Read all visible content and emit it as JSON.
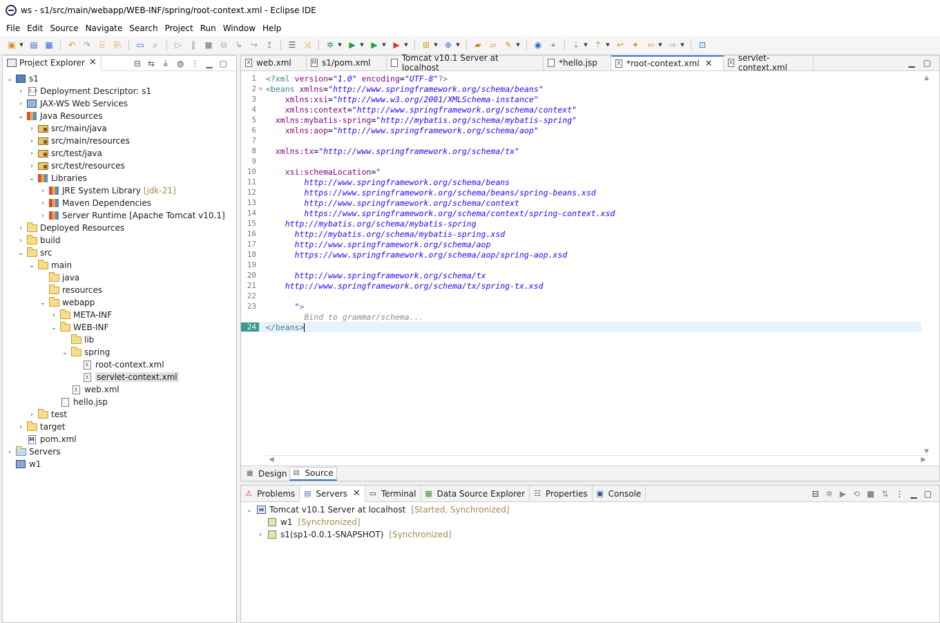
{
  "window": {
    "title": "ws - s1/src/main/webapp/WEB-INF/spring/root-context.xml - Eclipse IDE"
  },
  "menu": [
    "File",
    "Edit",
    "Source",
    "Navigate",
    "Search",
    "Project",
    "Run",
    "Window",
    "Help"
  ],
  "explorer": {
    "tab_label": "Project Explorer",
    "tree": [
      {
        "level": 0,
        "twisty": "open",
        "icon": "project",
        "label": "s1",
        "decoration": ""
      },
      {
        "level": 1,
        "twisty": "closed",
        "icon": "descriptor",
        "label": "Deployment Descriptor: s1",
        "decoration": ""
      },
      {
        "level": 1,
        "twisty": "closed",
        "icon": "webservices",
        "label": "JAX-WS Web Services",
        "decoration": ""
      },
      {
        "level": 1,
        "twisty": "open",
        "icon": "java-resources",
        "label": "Java Resources",
        "decoration": ""
      },
      {
        "level": 2,
        "twisty": "closed",
        "icon": "source-folder",
        "label": "src/main/java",
        "decoration": ""
      },
      {
        "level": 2,
        "twisty": "closed",
        "icon": "source-folder",
        "label": "src/main/resources",
        "decoration": ""
      },
      {
        "level": 2,
        "twisty": "closed",
        "icon": "source-folder",
        "label": "src/test/java",
        "decoration": ""
      },
      {
        "level": 2,
        "twisty": "closed",
        "icon": "source-folder",
        "label": "src/test/resources",
        "decoration": ""
      },
      {
        "level": 2,
        "twisty": "open",
        "icon": "library",
        "label": "Libraries",
        "decoration": ""
      },
      {
        "level": 3,
        "twisty": "closed",
        "icon": "library",
        "label": "JRE System Library",
        "decoration": "[jdk-21]"
      },
      {
        "level": 3,
        "twisty": "closed",
        "icon": "library",
        "label": "Maven Dependencies",
        "decoration": ""
      },
      {
        "level": 3,
        "twisty": "closed",
        "icon": "library",
        "label": "Server Runtime [Apache Tomcat v10.1]",
        "decoration": ""
      },
      {
        "level": 1,
        "twisty": "closed",
        "icon": "folder",
        "label": "Deployed Resources",
        "decoration": ""
      },
      {
        "level": 1,
        "twisty": "closed",
        "icon": "folder",
        "label": "build",
        "decoration": ""
      },
      {
        "level": 1,
        "twisty": "open",
        "icon": "folder",
        "label": "src",
        "decoration": ""
      },
      {
        "level": 2,
        "twisty": "open",
        "icon": "folder",
        "label": "main",
        "decoration": ""
      },
      {
        "level": 3,
        "twisty": "none",
        "icon": "folder",
        "label": "java",
        "decoration": ""
      },
      {
        "level": 3,
        "twisty": "none",
        "icon": "folder",
        "label": "resources",
        "decoration": ""
      },
      {
        "level": 3,
        "twisty": "open",
        "icon": "folder",
        "label": "webapp",
        "decoration": ""
      },
      {
        "level": 4,
        "twisty": "closed",
        "icon": "folder",
        "label": "META-INF",
        "decoration": ""
      },
      {
        "level": 4,
        "twisty": "open",
        "icon": "folder",
        "label": "WEB-INF",
        "decoration": ""
      },
      {
        "level": 5,
        "twisty": "none",
        "icon": "folder",
        "label": "lib",
        "decoration": ""
      },
      {
        "level": 5,
        "twisty": "open",
        "icon": "folder",
        "label": "spring",
        "decoration": ""
      },
      {
        "level": 6,
        "twisty": "none",
        "icon": "xml",
        "label": "root-context.xml",
        "decoration": ""
      },
      {
        "level": 6,
        "twisty": "none",
        "icon": "xml",
        "label": "servlet-context.xml",
        "decoration": "",
        "selected": true
      },
      {
        "level": 5,
        "twisty": "none",
        "icon": "xml",
        "label": "web.xml",
        "decoration": ""
      },
      {
        "level": 4,
        "twisty": "none",
        "icon": "jsp",
        "label": "hello.jsp",
        "decoration": ""
      },
      {
        "level": 2,
        "twisty": "closed",
        "icon": "folder",
        "label": "test",
        "decoration": ""
      },
      {
        "level": 1,
        "twisty": "closed",
        "icon": "folder",
        "label": "target",
        "decoration": ""
      },
      {
        "level": 1,
        "twisty": "none",
        "icon": "maven",
        "label": "pom.xml",
        "decoration": ""
      },
      {
        "level": 0,
        "twisty": "closed",
        "icon": "server-folder",
        "label": "Servers",
        "decoration": ""
      },
      {
        "level": 0,
        "twisty": "none",
        "icon": "project-closed",
        "label": "w1",
        "decoration": ""
      }
    ]
  },
  "editor": {
    "tabs": [
      {
        "label": "web.xml",
        "icon": "x",
        "active": false,
        "closable": false
      },
      {
        "label": "s1/pom.xml",
        "icon": "m",
        "active": false,
        "closable": false
      },
      {
        "label": "Tomcat v10.1 Server at localhost",
        "icon": "server",
        "active": false,
        "closable": false
      },
      {
        "label": "*hello.jsp",
        "icon": "jsp",
        "active": false,
        "closable": false
      },
      {
        "label": "*root-context.xml",
        "icon": "x",
        "active": true,
        "closable": true
      },
      {
        "label": "servlet-context.xml",
        "icon": "x",
        "active": false,
        "closable": false
      }
    ],
    "lines": [
      {
        "n": "1",
        "fold": "",
        "tokens": [
          [
            "tag",
            "<?xml "
          ],
          [
            "attr",
            "version"
          ],
          [
            "plain",
            "="
          ],
          [
            "val",
            "\"1.0\""
          ],
          [
            "plain",
            " "
          ],
          [
            "attr",
            "encoding"
          ],
          [
            "plain",
            "="
          ],
          [
            "val",
            "\"UTF-8\""
          ],
          [
            "tag",
            "?>"
          ]
        ]
      },
      {
        "n": "2",
        "fold": "⊖",
        "tokens": [
          [
            "tag",
            "<beans "
          ],
          [
            "attr",
            "xmlns"
          ],
          [
            "plain",
            "="
          ],
          [
            "val",
            "\"http://www.springframework.org/schema/beans\""
          ]
        ]
      },
      {
        "n": "3",
        "fold": "",
        "tokens": [
          [
            "plain",
            "    "
          ],
          [
            "attr",
            "xmlns:xsi"
          ],
          [
            "plain",
            "="
          ],
          [
            "val",
            "\"http://www.w3.org/2001/XMLSchema-instance\""
          ]
        ]
      },
      {
        "n": "4",
        "fold": "",
        "tokens": [
          [
            "plain",
            "    "
          ],
          [
            "attr",
            "xmlns:context"
          ],
          [
            "plain",
            "="
          ],
          [
            "val",
            "\"http://www.springframework.org/schema/context\""
          ]
        ]
      },
      {
        "n": "5",
        "fold": "",
        "tokens": [
          [
            "plain",
            "  "
          ],
          [
            "attr",
            "xmlns:mybatis-spring"
          ],
          [
            "plain",
            "="
          ],
          [
            "val",
            "\"http://mybatis.org/schema/mybatis-spring\""
          ]
        ]
      },
      {
        "n": "6",
        "fold": "",
        "tokens": [
          [
            "plain",
            "    "
          ],
          [
            "attr",
            "xmlns:aop"
          ],
          [
            "plain",
            "="
          ],
          [
            "val",
            "\"http://www.springframework.org/schema/aop\""
          ]
        ]
      },
      {
        "n": "7",
        "fold": "",
        "tokens": []
      },
      {
        "n": "8",
        "fold": "",
        "tokens": [
          [
            "plain",
            "  "
          ],
          [
            "attr",
            "xmlns:tx"
          ],
          [
            "plain",
            "="
          ],
          [
            "val",
            "\"http://www.springframework.org/schema/tx\""
          ]
        ]
      },
      {
        "n": "9",
        "fold": "",
        "tokens": []
      },
      {
        "n": "10",
        "fold": "",
        "tokens": [
          [
            "plain",
            "    "
          ],
          [
            "attr",
            "xsi:schemaLocation"
          ],
          [
            "plain",
            "="
          ],
          [
            "val",
            "\""
          ]
        ]
      },
      {
        "n": "11",
        "fold": "",
        "tokens": [
          [
            "val",
            "        http://www.springframework.org/schema/beans"
          ]
        ]
      },
      {
        "n": "12",
        "fold": "",
        "tokens": [
          [
            "val",
            "        https://www.springframework.org/schema/beans/spring-beans.xsd"
          ]
        ]
      },
      {
        "n": "13",
        "fold": "",
        "tokens": [
          [
            "val",
            "        http://www.springframework.org/schema/context"
          ]
        ]
      },
      {
        "n": "14",
        "fold": "",
        "tokens": [
          [
            "val",
            "        https://www.springframework.org/schema/context/spring-context.xsd"
          ]
        ]
      },
      {
        "n": "15",
        "fold": "",
        "tokens": [
          [
            "val",
            "    http://mybatis.org/schema/mybatis-spring"
          ]
        ]
      },
      {
        "n": "16",
        "fold": "",
        "tokens": [
          [
            "val",
            "      http://mybatis.org/schema/mybatis-spring.xsd"
          ]
        ]
      },
      {
        "n": "17",
        "fold": "",
        "tokens": [
          [
            "val",
            "      http://www.springframework.org/schema/aop"
          ]
        ]
      },
      {
        "n": "18",
        "fold": "",
        "tokens": [
          [
            "val",
            "      https://www.springframework.org/schema/aop/spring-aop.xsd"
          ]
        ]
      },
      {
        "n": "19",
        "fold": "",
        "tokens": []
      },
      {
        "n": "20",
        "fold": "",
        "tokens": [
          [
            "val",
            "      http://www.springframework.org/schema/tx"
          ]
        ]
      },
      {
        "n": "21",
        "fold": "",
        "tokens": [
          [
            "val",
            "    http://www.springframework.org/schema/tx/spring-tx.xsd"
          ]
        ]
      },
      {
        "n": "22",
        "fold": "",
        "tokens": []
      },
      {
        "n": "23",
        "fold": "",
        "tokens": [
          [
            "val",
            "      \""
          ],
          [
            "tag",
            ">"
          ]
        ]
      },
      {
        "n": "",
        "fold": "",
        "tokens": [
          [
            "hint",
            "        Bind to grammar/schema..."
          ]
        ]
      },
      {
        "n": "24",
        "fold": "",
        "tokens": [
          [
            "tag",
            "</beans>"
          ]
        ],
        "current": true
      }
    ],
    "mode_tabs": [
      {
        "label": "Design",
        "active": false
      },
      {
        "label": "Source",
        "active": true
      }
    ]
  },
  "servers_view": {
    "tabs": [
      {
        "label": "Problems",
        "icon": "problems",
        "active": false,
        "closable": false
      },
      {
        "label": "Servers",
        "icon": "servers",
        "active": true,
        "closable": true
      },
      {
        "label": "Terminal",
        "icon": "terminal",
        "active": false,
        "closable": false
      },
      {
        "label": "Data Source Explorer",
        "icon": "datasource",
        "active": false,
        "closable": false
      },
      {
        "label": "Properties",
        "icon": "properties",
        "active": false,
        "closable": false
      },
      {
        "label": "Console",
        "icon": "console",
        "active": false,
        "closable": false
      }
    ],
    "rows": [
      {
        "level": 0,
        "twisty": "open",
        "icon": "tomcat",
        "label": "Tomcat v10.1 Server at localhost",
        "state": "[Started, Synchronized]"
      },
      {
        "level": 1,
        "twisty": "none",
        "icon": "module",
        "label": "w1",
        "state": "[Synchronized]"
      },
      {
        "level": 1,
        "twisty": "closed",
        "icon": "module",
        "label": "s1(sp1-0.0.1-SNAPSHOT)",
        "state": "[Synchronized]"
      }
    ]
  }
}
